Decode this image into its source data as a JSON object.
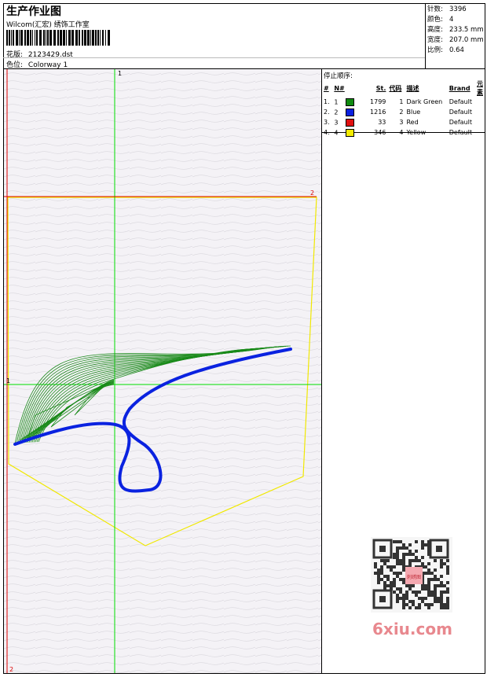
{
  "header": {
    "title": "生产作业图",
    "company": "Wilcom(汇宏) 绣饰工作室",
    "pattern_label": "花版:",
    "pattern_value": "2123429.dst",
    "colorway_label": "色位:",
    "colorway_value": "Colorway 1"
  },
  "stats": {
    "stitches_label": "针数:",
    "stitches_value": "3396",
    "colors_label": "颜色:",
    "colors_value": "4",
    "height_label": "高度:",
    "height_value": "233.5 mm",
    "width_label": "宽度:",
    "width_value": "207.0 mm",
    "scale_label": "比例:",
    "scale_value": "0.64"
  },
  "stop_sequence": {
    "caption": "停止顺序:",
    "headers": [
      "#",
      "N#",
      "St.",
      "代码",
      "描述",
      "Brand",
      "元素"
    ],
    "rows": [
      {
        "num": "1.",
        "n": "1",
        "color": "#0f8a0f",
        "st": "1799",
        "code": "1",
        "desc": "Dark Green",
        "brand": "Default"
      },
      {
        "num": "2.",
        "n": "2",
        "color": "#0a20e0",
        "st": "1216",
        "code": "2",
        "desc": "Blue",
        "brand": "Default"
      },
      {
        "num": "3.",
        "n": "3",
        "color": "#e01010",
        "st": "33",
        "code": "3",
        "desc": "Red",
        "brand": "Default"
      },
      {
        "num": "4.",
        "n": "4",
        "color": "#f4ec00",
        "st": "346",
        "code": "4",
        "desc": "Yellow",
        "brand": "Default"
      }
    ]
  },
  "design": {
    "marker_top": "1",
    "marker_left": "1",
    "marker_red_right": "2",
    "marker_red_bottom": "2",
    "guide_green": "#00dd00",
    "guide_red": "#dd0000",
    "outline_yellow": "#f0e800",
    "stitch_green": "#1a8a1a",
    "stitch_blue": "#0a22e0"
  },
  "watermark": {
    "seal_text": "刺绣图",
    "site": "6xiu.com"
  }
}
